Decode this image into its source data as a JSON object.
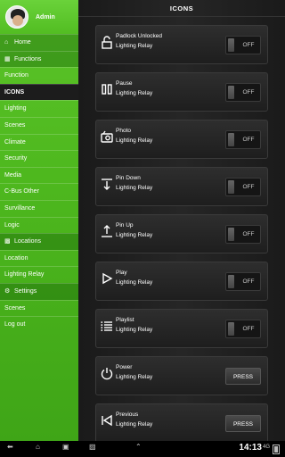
{
  "user": {
    "name": "Admin"
  },
  "sidebar": {
    "items": [
      {
        "label": "Home",
        "icon": "house-icon",
        "type": "section"
      },
      {
        "label": "Functions",
        "icon": "grid-icon",
        "type": "section"
      },
      {
        "label": "Function",
        "type": "item"
      },
      {
        "label": "ICONS",
        "type": "active"
      },
      {
        "label": "Lighting",
        "type": "item"
      },
      {
        "label": "Scenes",
        "type": "item"
      },
      {
        "label": "Climate",
        "type": "item"
      },
      {
        "label": "Security",
        "type": "item"
      },
      {
        "label": "Media",
        "type": "item"
      },
      {
        "label": "C-Bus Other",
        "type": "item"
      },
      {
        "label": "Survillance",
        "type": "item"
      },
      {
        "label": "Logic",
        "type": "item"
      },
      {
        "label": "Locations",
        "icon": "map-icon",
        "type": "section"
      },
      {
        "label": "Location",
        "type": "item"
      },
      {
        "label": "Lighting Relay",
        "type": "item"
      },
      {
        "label": "Settings",
        "icon": "gear-icon",
        "type": "section"
      },
      {
        "label": "Scenes",
        "type": "item"
      },
      {
        "label": "Log out",
        "type": "item"
      }
    ]
  },
  "header": {
    "title": "ICONS"
  },
  "cards": [
    {
      "name": "Padlock Unlocked",
      "sub": "Lighting Relay",
      "icon": "padlock-unlocked-icon",
      "control": "toggle",
      "state": "OFF"
    },
    {
      "name": "Pause",
      "sub": "Lighting Relay",
      "icon": "pause-icon",
      "control": "toggle",
      "state": "OFF"
    },
    {
      "name": "Photo",
      "sub": "Lighting Relay",
      "icon": "photo-icon",
      "control": "toggle",
      "state": "OFF"
    },
    {
      "name": "Pin Down",
      "sub": "Lighting Relay",
      "icon": "pin-down-icon",
      "control": "toggle",
      "state": "OFF"
    },
    {
      "name": "Pin Up",
      "sub": "Lighting Relay",
      "icon": "pin-up-icon",
      "control": "toggle",
      "state": "OFF"
    },
    {
      "name": "Play",
      "sub": "Lighting Relay",
      "icon": "play-icon",
      "control": "toggle",
      "state": "OFF"
    },
    {
      "name": "Playlist",
      "sub": "Lighting Relay",
      "icon": "playlist-icon",
      "control": "toggle",
      "state": "OFF"
    },
    {
      "name": "Power",
      "sub": "Lighting Relay",
      "icon": "power-icon",
      "control": "button",
      "state": "PRESS"
    },
    {
      "name": "Previous",
      "sub": "Lighting Relay",
      "icon": "previous-icon",
      "control": "button",
      "state": "PRESS"
    }
  ],
  "status": {
    "time": "14:13",
    "network": "4G"
  }
}
